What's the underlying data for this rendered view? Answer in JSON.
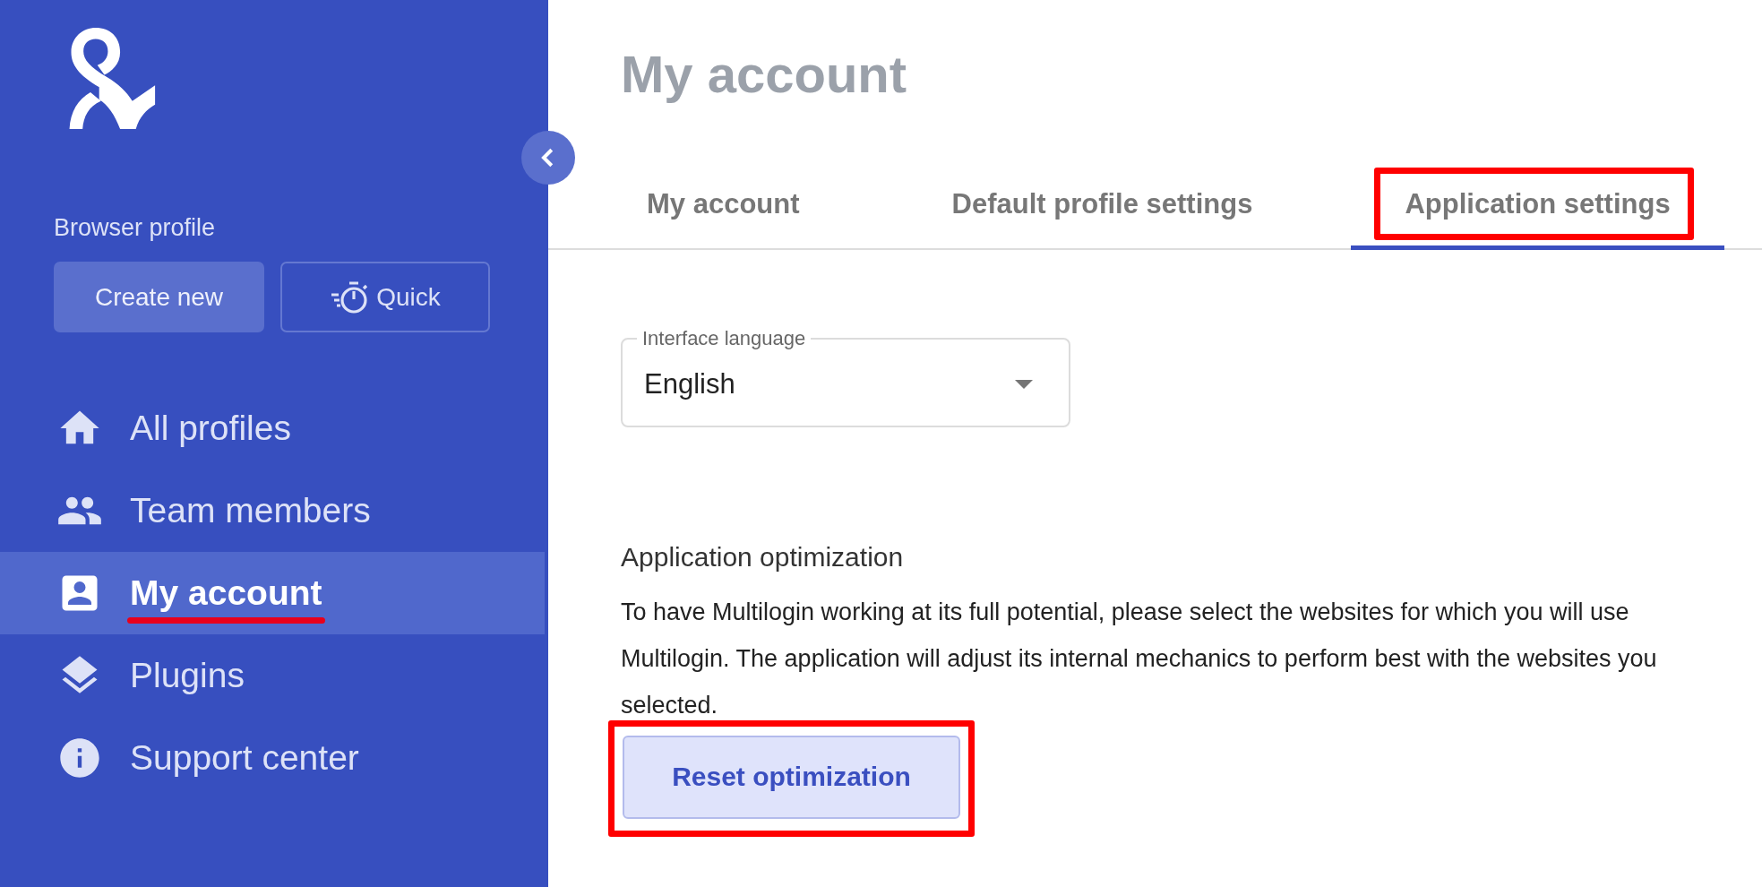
{
  "sidebar": {
    "section_label": "Browser profile",
    "buttons": [
      {
        "label": "Create new",
        "kind": "filled"
      },
      {
        "label": "Quick",
        "kind": "outlined"
      }
    ],
    "nav_items": [
      {
        "label": "All profiles",
        "kind": "home",
        "selected": false
      },
      {
        "label": "Team members",
        "kind": "people",
        "selected": false
      },
      {
        "label": "My account",
        "kind": "account",
        "selected": true
      },
      {
        "label": "Plugins",
        "kind": "layers",
        "selected": false
      },
      {
        "label": "Support center",
        "kind": "info",
        "selected": false
      }
    ]
  },
  "page_title": "My account",
  "tabs": [
    {
      "label": "My account",
      "selected": false
    },
    {
      "label": "Default profile settings",
      "selected": false
    },
    {
      "label": "Application settings",
      "selected": true
    }
  ],
  "language_field": {
    "label": "Interface language",
    "value": "English"
  },
  "optimization": {
    "heading": "Application optimization",
    "text": "To have Multilogin working at its full potential, please select the websites for which you will use Multilogin. The application will adjust its internal mechanics to perform best with the websites you selected.",
    "button": "Reset optimization"
  }
}
